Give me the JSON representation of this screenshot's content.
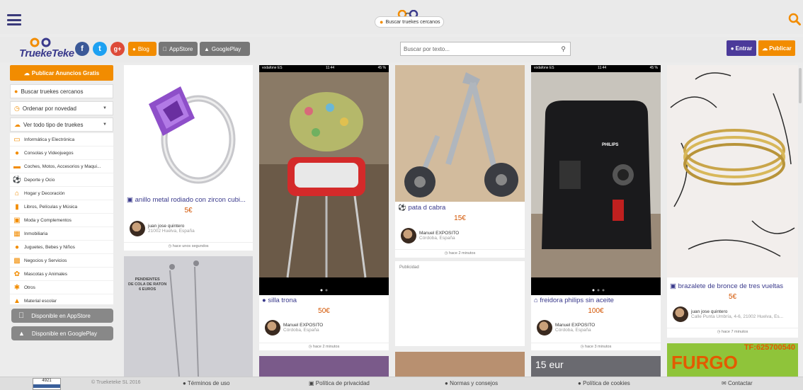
{
  "topbar": {
    "location_pill": "Buscar truekes cercanos"
  },
  "header": {
    "brand": "TruekeTeke",
    "blog_label": "Blog",
    "appstore_label": "AppStore",
    "googleplay_label": "GooglePlay",
    "search_placeholder": "Buscar por texto...",
    "entrar_label": "Entrar",
    "publicar_label": "Publicar"
  },
  "sidebar": {
    "publish_button": "Publicar Anuncios Gratis",
    "nearby": "Buscar truekes cercanos",
    "sort": "Ordenar por novedad",
    "type_filter": "Ver todo tipo de truekes",
    "categories": [
      "Informática y Electrónica",
      "Consolas y Videojuegos",
      "Coches, Motos, Accesorios y Maqui...",
      "Deporte y Ocio",
      "Hogar y Decoración",
      "Libros, Películas y Música",
      "Moda y Complementos",
      "Inmobiliaria",
      "Juguetes, Bebes y Niños",
      "Negocios y Servicios",
      "Mascotas y Animales",
      "Otros",
      "Material escolar"
    ],
    "appstore": "Disponible en AppStore",
    "googleplay": "Disponible en GooglePlay"
  },
  "cards": [
    {
      "title": "anillo metal rodiado con zircon cubi...",
      "price": "5€",
      "seller": "juan jose quintero",
      "location": "21002 Huelva, España",
      "time": "hace unos segundos"
    },
    {
      "title": "silla trona",
      "price": "50€",
      "seller": "Manuel EXPOSITO",
      "location": "Córdoba, España",
      "time": "hace 2 minutos",
      "status_left": "vodafone ES",
      "status_time": "11:44",
      "status_right": "45 %"
    },
    {
      "title": "pata d cabra",
      "price": "15€",
      "seller": "Manuel EXPOSITO",
      "location": "Córdoba, España",
      "time": "hace 2 minutos"
    },
    {
      "title": "freidora philips sin aceite",
      "price": "100€",
      "seller": "Manuel EXPOSITO",
      "location": "Córdoba, España",
      "time": "hace 3 minutos",
      "status_left": "vodafone ES",
      "status_time": "11:44",
      "status_right": "45 %",
      "appliance_brand": "PHILIPS"
    },
    {
      "title": "brazalete de bronce de tres vueltas",
      "price": "5€",
      "seller": "juan jose quintero",
      "location": "Calle Punta Umbría, 4-6, 21002 Huelva, Es...",
      "time": "hace 7 minutos"
    }
  ],
  "pendientes_text": "PENDIENTES\nDE COLA DE RATON\n6 EUROS",
  "ad_label": "Publicidad",
  "phone_banner": "TF:625700540",
  "furgo_text": "FURGO",
  "price_banner": "15 eur",
  "footer": {
    "counter": "4921",
    "copyright": "© Trueketeke SL 2016",
    "terms": "Términos de uso",
    "privacy": "Política de privacidad",
    "rules": "Normas y consejos",
    "cookies": "Política de cookies",
    "contact": "Contactar"
  },
  "colors": {
    "orange": "#f28c00",
    "purple": "#4b3a9a",
    "navy": "#3a3a8c"
  }
}
